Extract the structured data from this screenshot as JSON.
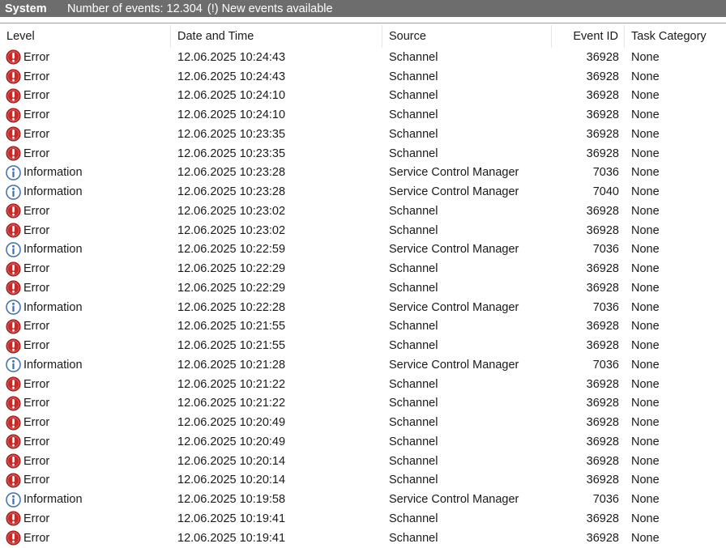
{
  "titlebar": {
    "log_name": "System",
    "event_count": "Number of events: 12.304",
    "new_events": "(!) New events available"
  },
  "columns": {
    "level": "Level",
    "date_time": "Date and Time",
    "source": "Source",
    "event_id": "Event ID",
    "task_category": "Task Category"
  },
  "colors": {
    "error_icon": "#c42b2b",
    "info_icon": "#3f6fb5",
    "titlebar_bg": "#6d6d6d"
  },
  "rows": [
    {
      "level": "Error",
      "icon": "error-icon",
      "date": "12.06.2025 10:24:43",
      "source": "Schannel",
      "event_id": "36928",
      "task": "None"
    },
    {
      "level": "Error",
      "icon": "error-icon",
      "date": "12.06.2025 10:24:43",
      "source": "Schannel",
      "event_id": "36928",
      "task": "None"
    },
    {
      "level": "Error",
      "icon": "error-icon",
      "date": "12.06.2025 10:24:10",
      "source": "Schannel",
      "event_id": "36928",
      "task": "None"
    },
    {
      "level": "Error",
      "icon": "error-icon",
      "date": "12.06.2025 10:24:10",
      "source": "Schannel",
      "event_id": "36928",
      "task": "None"
    },
    {
      "level": "Error",
      "icon": "error-icon",
      "date": "12.06.2025 10:23:35",
      "source": "Schannel",
      "event_id": "36928",
      "task": "None"
    },
    {
      "level": "Error",
      "icon": "error-icon",
      "date": "12.06.2025 10:23:35",
      "source": "Schannel",
      "event_id": "36928",
      "task": "None"
    },
    {
      "level": "Information",
      "icon": "info-icon",
      "date": "12.06.2025 10:23:28",
      "source": "Service Control Manager",
      "event_id": "7036",
      "task": "None"
    },
    {
      "level": "Information",
      "icon": "info-icon",
      "date": "12.06.2025 10:23:28",
      "source": "Service Control Manager",
      "event_id": "7040",
      "task": "None"
    },
    {
      "level": "Error",
      "icon": "error-icon",
      "date": "12.06.2025 10:23:02",
      "source": "Schannel",
      "event_id": "36928",
      "task": "None"
    },
    {
      "level": "Error",
      "icon": "error-icon",
      "date": "12.06.2025 10:23:02",
      "source": "Schannel",
      "event_id": "36928",
      "task": "None"
    },
    {
      "level": "Information",
      "icon": "info-icon",
      "date": "12.06.2025 10:22:59",
      "source": "Service Control Manager",
      "event_id": "7036",
      "task": "None"
    },
    {
      "level": "Error",
      "icon": "error-icon",
      "date": "12.06.2025 10:22:29",
      "source": "Schannel",
      "event_id": "36928",
      "task": "None"
    },
    {
      "level": "Error",
      "icon": "error-icon",
      "date": "12.06.2025 10:22:29",
      "source": "Schannel",
      "event_id": "36928",
      "task": "None"
    },
    {
      "level": "Information",
      "icon": "info-icon",
      "date": "12.06.2025 10:22:28",
      "source": "Service Control Manager",
      "event_id": "7036",
      "task": "None"
    },
    {
      "level": "Error",
      "icon": "error-icon",
      "date": "12.06.2025 10:21:55",
      "source": "Schannel",
      "event_id": "36928",
      "task": "None"
    },
    {
      "level": "Error",
      "icon": "error-icon",
      "date": "12.06.2025 10:21:55",
      "source": "Schannel",
      "event_id": "36928",
      "task": "None"
    },
    {
      "level": "Information",
      "icon": "info-icon",
      "date": "12.06.2025 10:21:28",
      "source": "Service Control Manager",
      "event_id": "7036",
      "task": "None"
    },
    {
      "level": "Error",
      "icon": "error-icon",
      "date": "12.06.2025 10:21:22",
      "source": "Schannel",
      "event_id": "36928",
      "task": "None"
    },
    {
      "level": "Error",
      "icon": "error-icon",
      "date": "12.06.2025 10:21:22",
      "source": "Schannel",
      "event_id": "36928",
      "task": "None"
    },
    {
      "level": "Error",
      "icon": "error-icon",
      "date": "12.06.2025 10:20:49",
      "source": "Schannel",
      "event_id": "36928",
      "task": "None"
    },
    {
      "level": "Error",
      "icon": "error-icon",
      "date": "12.06.2025 10:20:49",
      "source": "Schannel",
      "event_id": "36928",
      "task": "None"
    },
    {
      "level": "Error",
      "icon": "error-icon",
      "date": "12.06.2025 10:20:14",
      "source": "Schannel",
      "event_id": "36928",
      "task": "None"
    },
    {
      "level": "Error",
      "icon": "error-icon",
      "date": "12.06.2025 10:20:14",
      "source": "Schannel",
      "event_id": "36928",
      "task": "None"
    },
    {
      "level": "Information",
      "icon": "info-icon",
      "date": "12.06.2025 10:19:58",
      "source": "Service Control Manager",
      "event_id": "7036",
      "task": "None"
    },
    {
      "level": "Error",
      "icon": "error-icon",
      "date": "12.06.2025 10:19:41",
      "source": "Schannel",
      "event_id": "36928",
      "task": "None"
    },
    {
      "level": "Error",
      "icon": "error-icon",
      "date": "12.06.2025 10:19:41",
      "source": "Schannel",
      "event_id": "36928",
      "task": "None"
    }
  ]
}
